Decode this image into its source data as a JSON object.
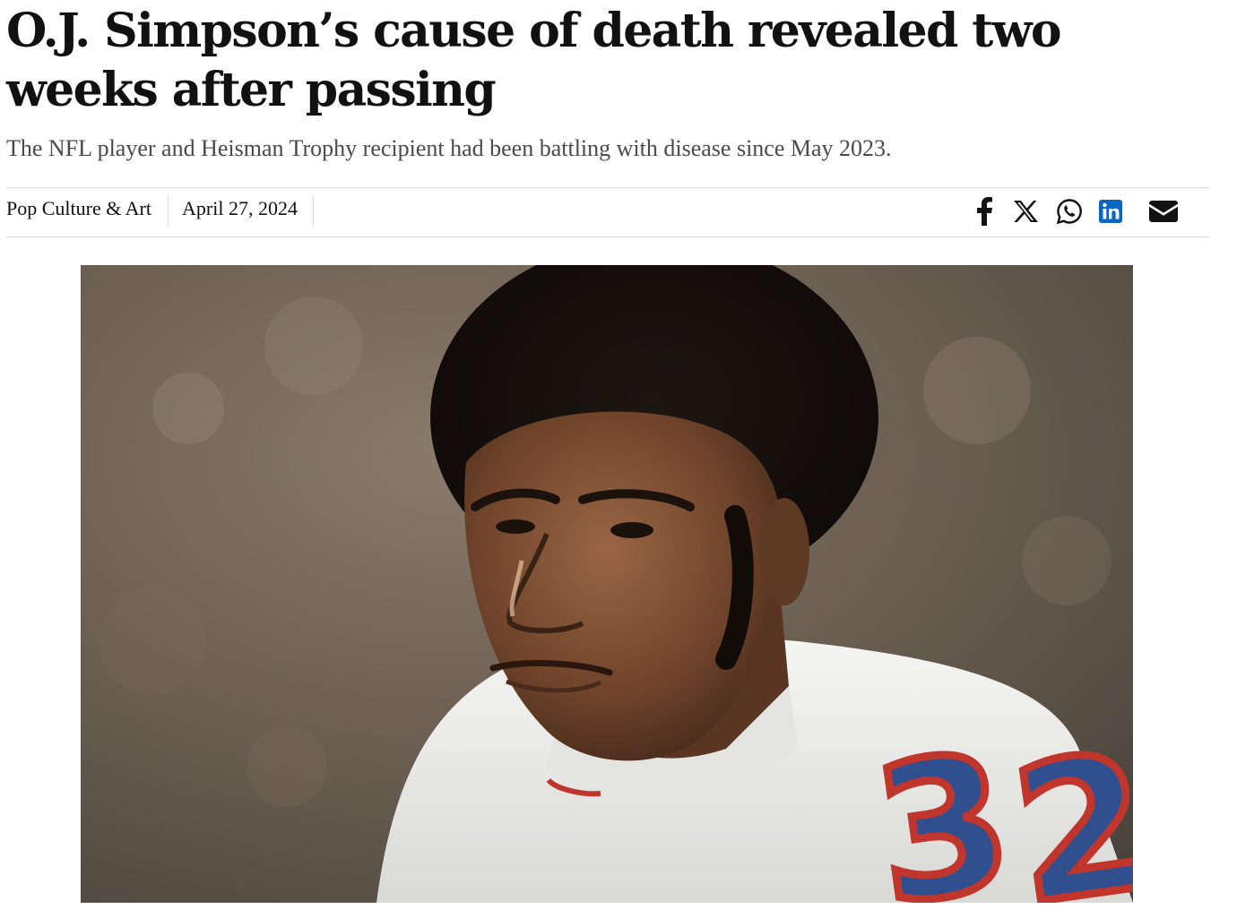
{
  "article": {
    "headline": "O.J. Simpson’s cause of death revealed two weeks after passing",
    "subheadline": "The NFL player and Heisman Trophy recipient had been battling with disease since May 2023."
  },
  "meta": {
    "category": "Pop Culture & Art",
    "date": "April 27, 2024"
  },
  "share": {
    "icons": [
      "facebook-icon",
      "x-icon",
      "whatsapp-icon",
      "linkedin-icon",
      "email-icon"
    ],
    "linkedin_color": "#0a66c2"
  },
  "hero_image": {
    "subject": "football player portrait",
    "jersey_number": "32",
    "colors": {
      "background": "#6f6253",
      "jersey": "#f4f4f2",
      "number": "#2f4f8f",
      "number_outline": "#c0362c"
    }
  }
}
